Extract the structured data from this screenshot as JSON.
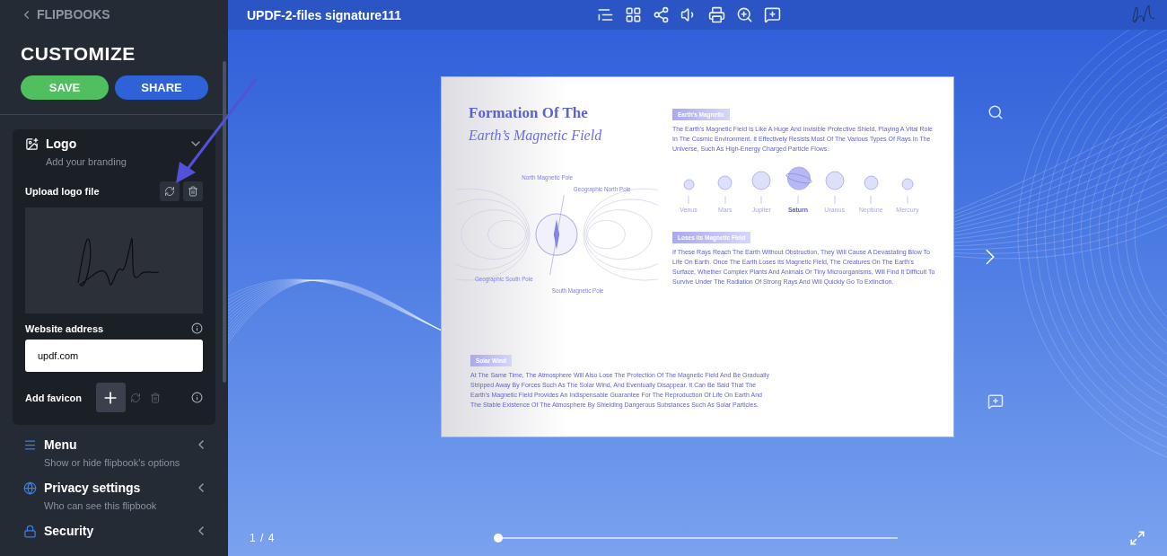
{
  "sidebar": {
    "back_link": "FLIPBOOKS",
    "title": "CUSTOMIZE",
    "buttons": [
      {
        "label": "SAVE",
        "kind": "save"
      },
      {
        "label": "SHARE",
        "kind": "share"
      }
    ],
    "sections": [
      {
        "title": "Logo",
        "subtitle": "Add your branding",
        "kind": "logo",
        "expanded": true,
        "upload_label": "Upload logo file",
        "website_label": "Website address",
        "website_value": "updf.com",
        "favicon_label": "Add favicon"
      },
      {
        "title": "Menu",
        "subtitle": "Show or hide flipbook's options",
        "kind": "menu",
        "expanded": false
      },
      {
        "title": "Privacy settings",
        "subtitle": "Who can see this flipbook",
        "kind": "privacy",
        "expanded": false
      },
      {
        "title": "Security",
        "kind": "security",
        "expanded": false
      }
    ]
  },
  "viewer": {
    "title": "UPDF-2-files signature111",
    "page_indicator": "1 / 4",
    "progress": {
      "level": 0
    }
  },
  "document": {
    "title_line1": "Formation Of The",
    "title_line2": "Earth’s Magnetic Field",
    "diagram_labels": [
      "North Magnetic Pole",
      "Geographic North Pole",
      "Geographic South Pole",
      "South Magnetic Pole"
    ],
    "sections": [
      {
        "tag": "Earth's Magnetic",
        "lines": [
          "The Earth's Magnetic Field Is Like A Huge And Invisible Protective Shield,",
          "Playing A Vital Role In The Cosmic Environment. It Effectively Resists Most",
          "Of The Various Types Of Rays In The Universe, Such As High-Energy",
          "Charged Particle Flows."
        ]
      },
      {
        "tag": "Loses Its Magnetic Field",
        "lines": [
          "If These Rays Reach The Earth Without Obstruction, They Will Cause A",
          "Devastating Blow To Life On Earth. Once The Earth Loses Its Magnetic",
          "Field, The Creatures On The Earth's Surface, Whether Complex Plants And",
          "Animals Or Tiny Microorganisms, Will Find It Difficult To Survive Under The",
          "Radiation Of Strong Rays And Will Quickly Go To Extinction."
        ]
      },
      {
        "tag": "Solar Wind",
        "lines": [
          "At The Same Time, The Atmosphere Will Also Lose The Protection Of The Magnetic Field And Be Gradually",
          "Stripped Away By Forces Such As The Solar Wind, And Eventually Disappear. It Can Be Said That The",
          "Earth's Magnetic Field Provides An Indispensable Guarantee For The Reproduction Of Life On Earth And",
          "The Stable Existence Of The Atmosphere By Shielding Dangerous Substances Such As Solar Particles."
        ]
      }
    ],
    "planets": [
      {
        "name": "Venus",
        "selected": false
      },
      {
        "name": "Mars",
        "selected": false
      },
      {
        "name": "Jupiter",
        "selected": false
      },
      {
        "name": "Saturn",
        "selected": true
      },
      {
        "name": "Uranus",
        "selected": false
      },
      {
        "name": "Neptune",
        "selected": false
      },
      {
        "name": "Mercury",
        "selected": false
      }
    ]
  }
}
